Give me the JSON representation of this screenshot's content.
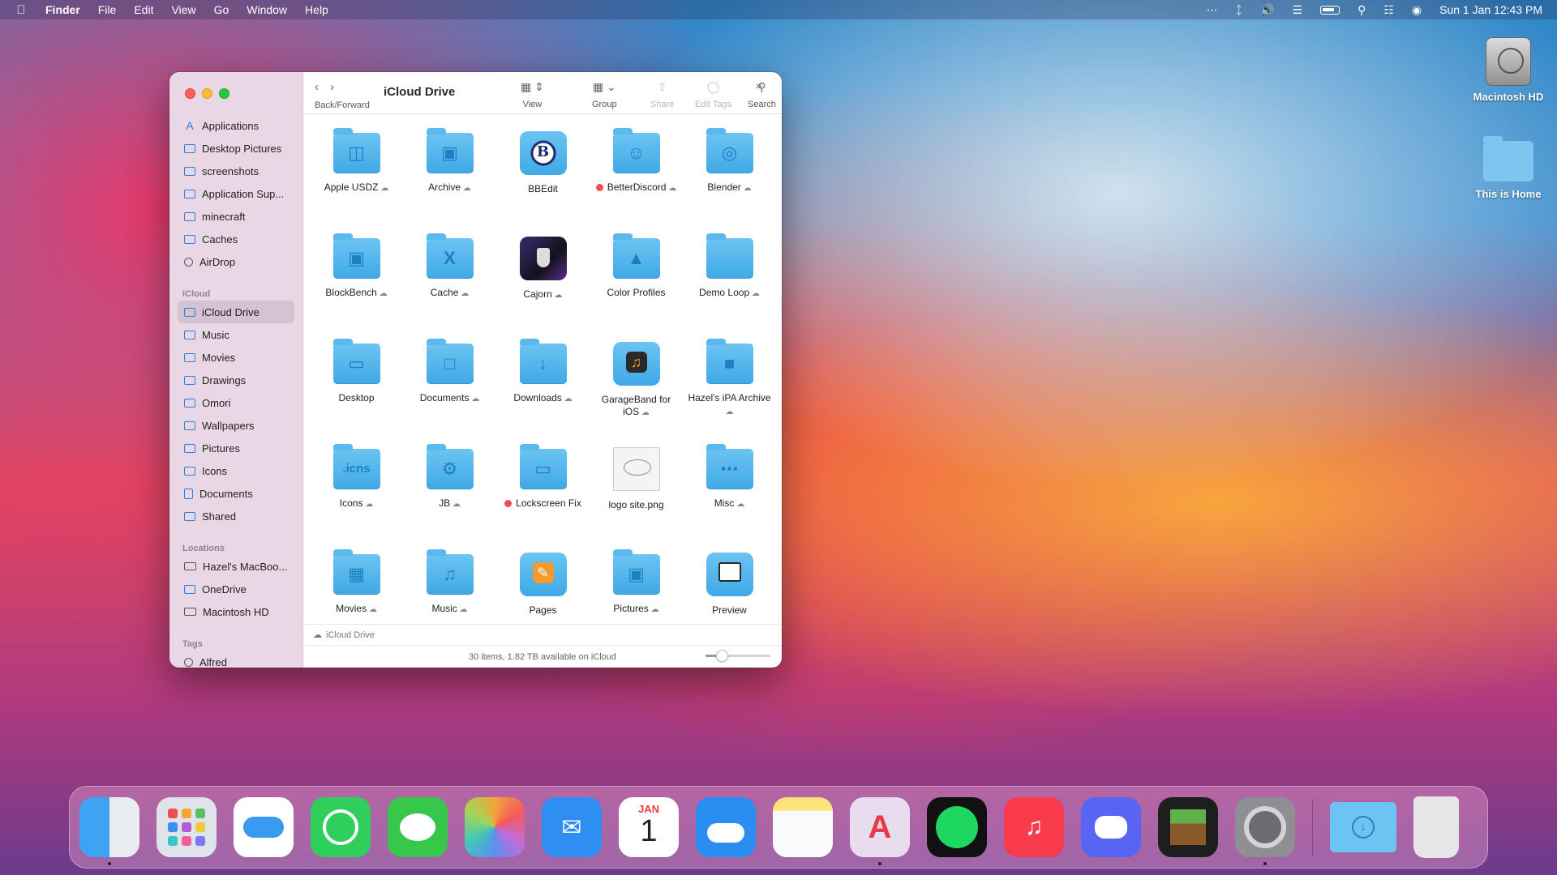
{
  "menubar": {
    "app": "Finder",
    "menus": [
      "File",
      "Edit",
      "View",
      "Go",
      "Window",
      "Help"
    ],
    "clock": "Sun 1 Jan  12:43 PM"
  },
  "desktop": {
    "icons": [
      {
        "label": "Macintosh HD"
      },
      {
        "label": "This is Home"
      }
    ]
  },
  "window": {
    "title": "iCloud Drive",
    "toolbar": {
      "back_forward": "Back/Forward",
      "view": "View",
      "group": "Group",
      "share": "Share",
      "edit_tags": "Edit Tags",
      "search": "Search"
    },
    "sidebar": {
      "favorites": [
        {
          "label": "Applications",
          "icon": "applications-icon"
        },
        {
          "label": "Desktop Pictures",
          "icon": "folder-icon"
        },
        {
          "label": "screenshots",
          "icon": "folder-icon"
        },
        {
          "label": "Application Sup...",
          "icon": "folder-icon"
        },
        {
          "label": "minecraft",
          "icon": "folder-icon"
        },
        {
          "label": "Caches",
          "icon": "folder-icon"
        },
        {
          "label": "AirDrop",
          "icon": "airdrop-icon"
        }
      ],
      "icloud_header": "iCloud",
      "icloud": [
        {
          "label": "iCloud Drive",
          "icon": "cloud-icon",
          "selected": true
        },
        {
          "label": "Music",
          "icon": "folder-icon"
        },
        {
          "label": "Movies",
          "icon": "folder-icon"
        },
        {
          "label": "Drawings",
          "icon": "folder-icon"
        },
        {
          "label": "Omori",
          "icon": "folder-icon"
        },
        {
          "label": "Wallpapers",
          "icon": "folder-icon"
        },
        {
          "label": "Pictures",
          "icon": "folder-icon"
        },
        {
          "label": "Icons",
          "icon": "folder-icon"
        },
        {
          "label": "Documents",
          "icon": "document-icon"
        },
        {
          "label": "Shared",
          "icon": "shared-folder-icon"
        }
      ],
      "locations_header": "Locations",
      "locations": [
        {
          "label": "Hazel's MacBoo...",
          "icon": "laptop-icon"
        },
        {
          "label": "OneDrive",
          "icon": "folder-icon"
        },
        {
          "label": "Macintosh HD",
          "icon": "disk-icon"
        }
      ],
      "tags_header": "Tags",
      "tags": [
        {
          "label": "Alfred",
          "icon": "tag-circle-icon"
        }
      ]
    },
    "items": [
      {
        "name": "Apple USDZ",
        "cloud": true
      },
      {
        "name": "Archive",
        "cloud": true
      },
      {
        "name": "BBEdit",
        "cloud": false
      },
      {
        "name": "BetterDiscord",
        "cloud": true,
        "tag": true
      },
      {
        "name": "Blender",
        "cloud": true
      },
      {
        "name": "BlockBench",
        "cloud": true
      },
      {
        "name": "Cache",
        "cloud": true
      },
      {
        "name": "Cajorn",
        "cloud": true
      },
      {
        "name": "Color Profiles",
        "cloud": false
      },
      {
        "name": "Demo Loop",
        "cloud": true
      },
      {
        "name": "Desktop",
        "cloud": false
      },
      {
        "name": "Documents",
        "cloud": true
      },
      {
        "name": "Downloads",
        "cloud": true
      },
      {
        "name": "GarageBand for iOS",
        "cloud": true
      },
      {
        "name": "Hazel's iPA Archive",
        "cloud": true
      },
      {
        "name": "Icons",
        "cloud": true
      },
      {
        "name": "JB",
        "cloud": true
      },
      {
        "name": "Lockscreen Fix",
        "cloud": false,
        "tag": true
      },
      {
        "name": "logo site.png",
        "cloud": false
      },
      {
        "name": "Misc",
        "cloud": true
      },
      {
        "name": "Movies",
        "cloud": true
      },
      {
        "name": "Music",
        "cloud": true
      },
      {
        "name": "Pages",
        "cloud": false
      },
      {
        "name": "Pictures",
        "cloud": true
      },
      {
        "name": "Preview",
        "cloud": false
      }
    ],
    "pathbar": "iCloud Drive",
    "status": "30 items, 1.82 TB available on iCloud",
    "icon_size_fraction": 0.25
  },
  "dock": {
    "apps": [
      {
        "name": "finder-icon",
        "color": "#3fa3f3",
        "running": true
      },
      {
        "name": "launchpad-icon",
        "color": "#dfe3ea",
        "running": false
      },
      {
        "name": "icloud-icon",
        "color": "#ffffff",
        "running": false
      },
      {
        "name": "whatsapp-icon",
        "color": "#2fcf5b",
        "running": false
      },
      {
        "name": "messages-icon",
        "color": "#37c74a",
        "running": false
      },
      {
        "name": "photos-icon",
        "color": "#ffffff",
        "running": false
      },
      {
        "name": "mail-icon",
        "color": "#2e8ef1",
        "running": false
      },
      {
        "name": "calendar-icon",
        "color": "#ffffff",
        "running": false
      },
      {
        "name": "weather-icon",
        "color": "#2a8ef0",
        "running": false
      },
      {
        "name": "notes-icon",
        "color": "#fbe27a",
        "running": false
      },
      {
        "name": "affinity-icon",
        "color": "#e8dcef",
        "running": true
      },
      {
        "name": "spotify-icon",
        "color": "#111111",
        "running": false
      },
      {
        "name": "music-icon",
        "color": "#fa3a4d",
        "running": false
      },
      {
        "name": "discord-icon",
        "color": "#5865f2",
        "running": false
      },
      {
        "name": "minecraft-icon",
        "color": "#1e1e1e",
        "running": false
      },
      {
        "name": "system-preferences-icon",
        "color": "#8e8e93",
        "running": true
      },
      {
        "name": "downloads-stack-icon",
        "color": "#6cc4f2",
        "running": false
      },
      {
        "name": "trash-icon",
        "color": "#e6e6e6",
        "running": false
      }
    ],
    "calendar": {
      "month": "JAN",
      "day": "1"
    }
  }
}
